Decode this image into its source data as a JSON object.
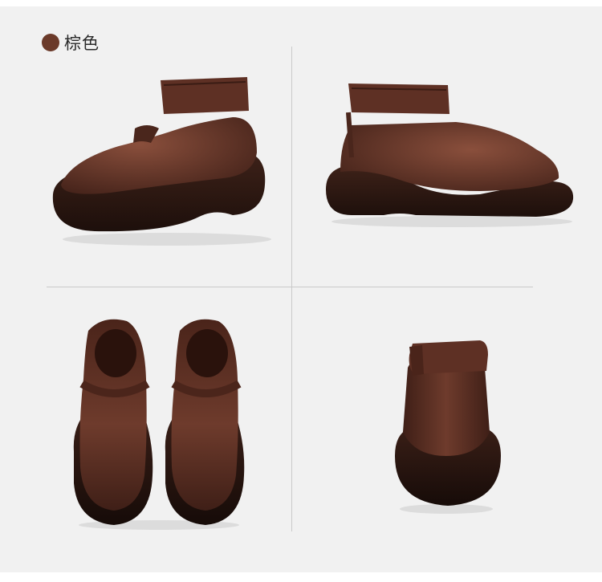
{
  "color_option": {
    "label": "棕色",
    "swatch_color": "#6b3a2a"
  },
  "colors": {
    "background": "#f1f1f1",
    "leather": "#5a2e22",
    "sole": "#2a1712"
  },
  "views": [
    {
      "name": "shoe-side-view-left",
      "icon": "shoe-side-left"
    },
    {
      "name": "shoe-side-view-right",
      "icon": "shoe-side-right"
    },
    {
      "name": "shoe-pair-front-view",
      "icon": "shoe-pair-front"
    },
    {
      "name": "shoe-back-view",
      "icon": "shoe-back"
    }
  ]
}
